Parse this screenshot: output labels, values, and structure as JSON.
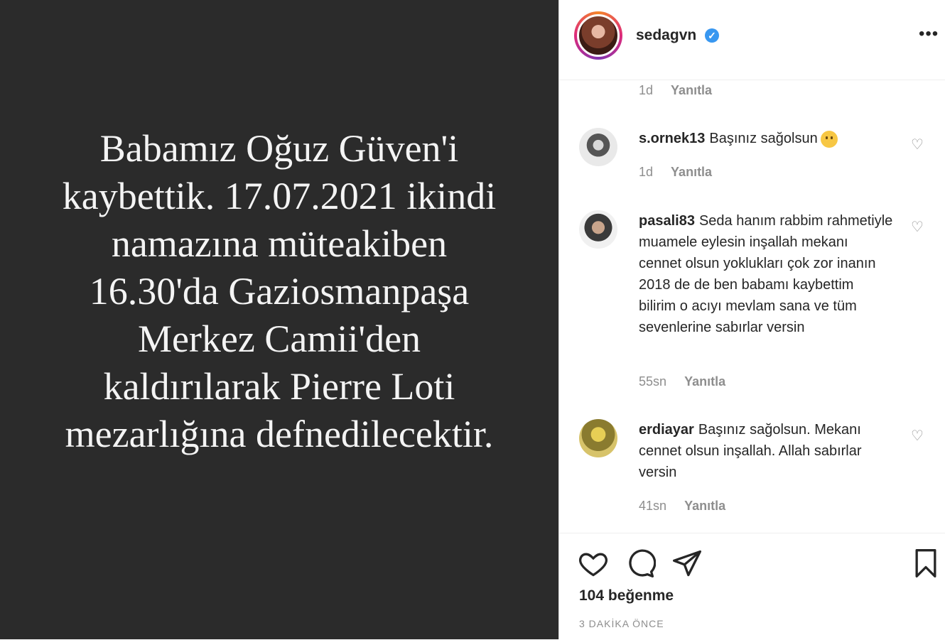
{
  "post": {
    "text": "Babamız Oğuz Güven'i\nkaybettik. 17.07.2021 ikindi\nnamazına müteakiben\n16.30'da  Gaziosmanpaşa\nMerkez Camii'den\nkaldırılarak Pierre Loti\nmezarlığına defnedilecektir."
  },
  "header": {
    "username": "sedagvn",
    "verified_mark": "✓",
    "more_label": "•••"
  },
  "comments": [
    {
      "meta_only": true,
      "time": "1d",
      "reply": "Yanıtla"
    },
    {
      "user": "s.ornek13",
      "text": "Başınız sağolsun",
      "emoji": "sad-face",
      "time": "1d",
      "reply": "Yanıtla"
    },
    {
      "user": "pasali83",
      "text": "Seda hanım rabbim rahmetiyle muamele eylesin inşallah mekanı cennet olsun yoklukları çok zor inanın 2018 de de ben babamı kaybettim bilirim o acıyı mevlam sana ve tüm sevenlerine sabırlar versin",
      "time": "55sn",
      "reply": "Yanıtla"
    },
    {
      "user": "erdiayar",
      "text": "Başınız sağolsun. Mekanı cennet olsun inşallah. Allah sabırlar versin",
      "time": "41sn",
      "reply": "Yanıtla"
    }
  ],
  "actions": {
    "icons": [
      "heart-icon",
      "comment-icon",
      "share-icon",
      "bookmark-icon"
    ],
    "likes": "104 beğenme",
    "time_ago": "3 DAKİKA ÖNCE"
  },
  "colors": {
    "post_bg": "#2b2b2b",
    "post_text": "#f4f4f4",
    "verified": "#3897f0",
    "muted": "#8e8e8e",
    "text": "#262626"
  }
}
